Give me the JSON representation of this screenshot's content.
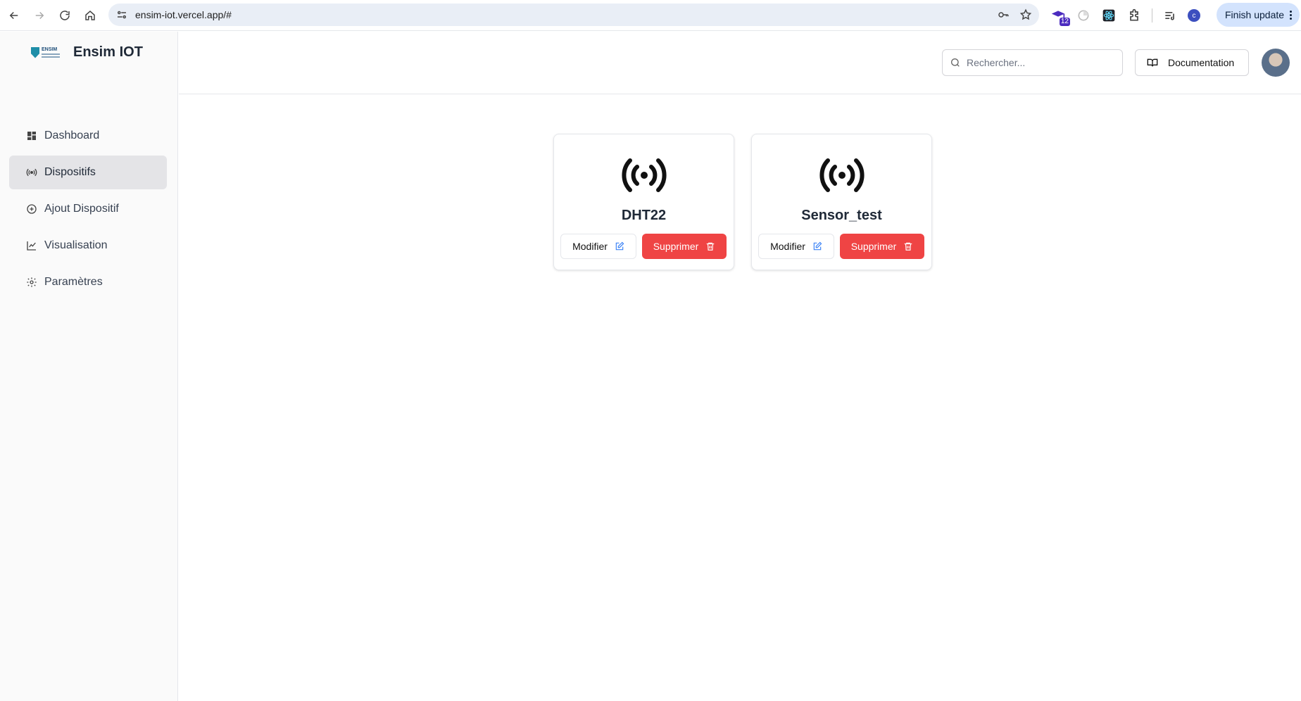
{
  "browser": {
    "url": "ensim-iot.vercel.app/#",
    "extension_badge": "12",
    "profile_initial": "c",
    "finish_update_label": "Finish update"
  },
  "app": {
    "brand_name": "Ensim IOT",
    "logo_text": "ENSIM"
  },
  "sidebar": {
    "items": [
      {
        "label": "Dashboard",
        "icon": "dashboard-icon",
        "active": false
      },
      {
        "label": "Dispositifs",
        "icon": "radio-signal-icon",
        "active": true
      },
      {
        "label": "Ajout Dispositif",
        "icon": "plus-circle-icon",
        "active": false
      },
      {
        "label": "Visualisation",
        "icon": "line-chart-icon",
        "active": false
      },
      {
        "label": "Paramètres",
        "icon": "gear-icon",
        "active": false
      }
    ]
  },
  "header": {
    "search_placeholder": "Rechercher...",
    "documentation_label": "Documentation"
  },
  "devices": [
    {
      "name": "DHT22",
      "edit_label": "Modifier",
      "delete_label": "Supprimer"
    },
    {
      "name": "Sensor_test",
      "edit_label": "Modifier",
      "delete_label": "Supprimer"
    }
  ],
  "colors": {
    "delete_button": "#ef4444",
    "edit_icon": "#3b82f6",
    "active_nav": "#e4e4e7"
  }
}
